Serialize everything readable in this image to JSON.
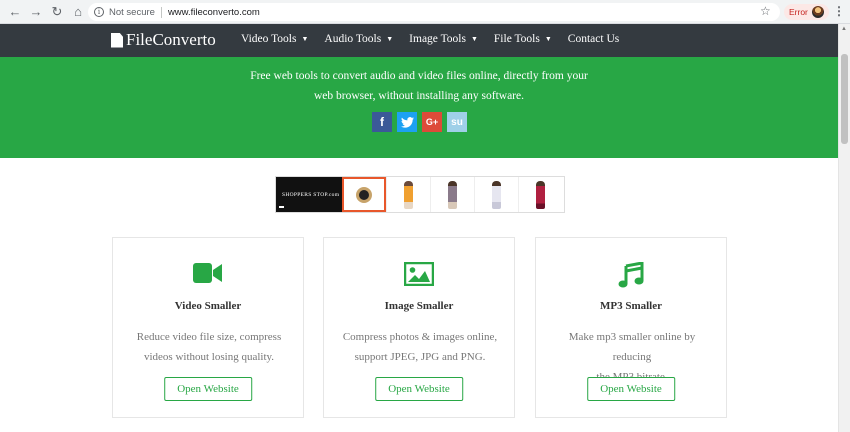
{
  "browser": {
    "security_label": "Not secure",
    "url": "www.fileconverto.com",
    "error_label": "Error"
  },
  "nav": {
    "brand": "FileConverto",
    "items": [
      {
        "label": "Video Tools",
        "has_dropdown": true
      },
      {
        "label": "Audio Tools",
        "has_dropdown": true
      },
      {
        "label": "Image Tools",
        "has_dropdown": true
      },
      {
        "label": "File Tools",
        "has_dropdown": true
      },
      {
        "label": "Contact Us",
        "has_dropdown": false
      }
    ]
  },
  "hero": {
    "tagline_line1": "Free web tools to convert audio and video files online, directly from your",
    "tagline_line2": "web browser, without installing any software.",
    "socials": [
      {
        "icon": "facebook-icon",
        "glyph": "f"
      },
      {
        "icon": "twitter-icon",
        "glyph": "🐦"
      },
      {
        "icon": "google-plus-icon",
        "glyph": "G+"
      },
      {
        "icon": "stumbleupon-icon",
        "glyph": "su"
      }
    ]
  },
  "ad": {
    "logo_text": "SHOPPERS STOP.com"
  },
  "cards": [
    {
      "icon": "video-camera-icon",
      "title": "Video Smaller",
      "desc_line1": "Reduce video file size, compress",
      "desc_line2": "videos without losing quality.",
      "button": "Open Website"
    },
    {
      "icon": "image-icon",
      "title": "Image Smaller",
      "desc_line1": "Compress photos & images online,",
      "desc_line2": "support JPEG, JPG and PNG.",
      "button": "Open Website"
    },
    {
      "icon": "music-note-icon",
      "title": "MP3 Smaller",
      "desc_line1": "Make mp3 smaller online by reducing",
      "desc_line2": "the MP3 bitrate.",
      "button": "Open Website"
    }
  ],
  "colors": {
    "brand_green": "#28a745",
    "nav_dark": "#343a40"
  }
}
